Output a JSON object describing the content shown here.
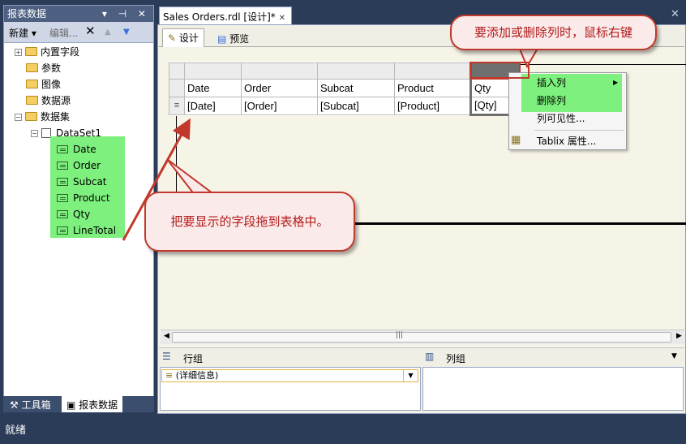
{
  "left_panel": {
    "title": "报表数据",
    "controls": "▾ ⊣ ✕",
    "toolbar": {
      "new_label": "新建",
      "edit_label": "编辑..."
    },
    "tree": [
      {
        "label": "内置字段"
      },
      {
        "label": "参数"
      },
      {
        "label": "图像"
      },
      {
        "label": "数据源"
      },
      {
        "label": "数据集"
      },
      {
        "label": "DataSet1"
      }
    ],
    "fields": [
      "Date",
      "Order",
      "Subcat",
      "Product",
      "Qty",
      "LineTotal"
    ],
    "bottom_tabs": {
      "toolbox": "工具箱",
      "report_data": "报表数据"
    }
  },
  "document": {
    "tab_title": "Sales Orders.rdl [设计]*",
    "subtabs": {
      "design": "设计",
      "preview": "预览"
    }
  },
  "tablix": {
    "headers": [
      "Date",
      "Order",
      "Subcat",
      "Product",
      "Qty"
    ],
    "details": [
      "[Date]",
      "[Order]",
      "[Subcat]",
      "[Product]",
      "[Qty]"
    ]
  },
  "context_menu": {
    "insert_column": "插入列",
    "delete_column": "删除列",
    "column_visibility": "列可见性...",
    "tablix_properties": "Tablix 属性..."
  },
  "groups": {
    "row_groups": "行组",
    "column_groups": "列组",
    "detail_group": "(详细信息)"
  },
  "callouts": {
    "top": "要添加或删除列时，鼠标右键",
    "middle": "把要显示的字段拖到表格中。"
  },
  "status": "就绪",
  "colors": {
    "highlight_green": "#7df07d",
    "callout_red": "#c0392b",
    "title_bar": "#4d6082"
  }
}
